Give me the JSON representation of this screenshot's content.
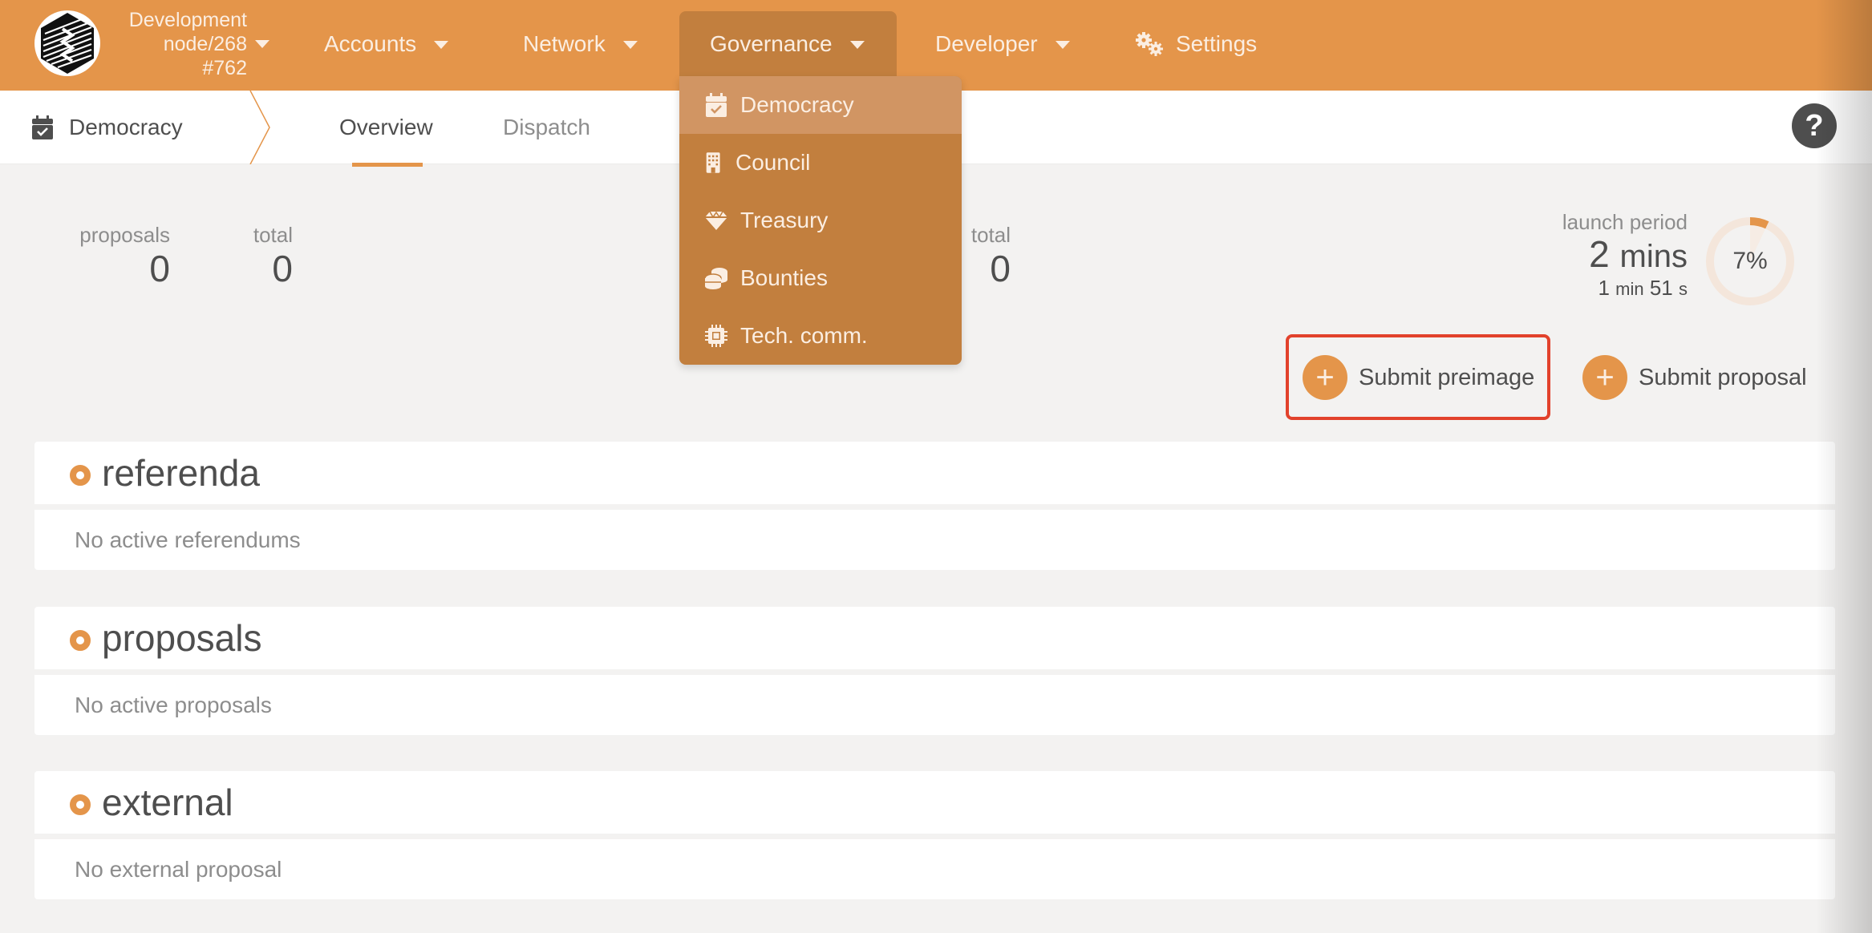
{
  "chain": {
    "name": "Development",
    "node": "node/268",
    "block": "#762"
  },
  "nav": {
    "items": [
      {
        "label": "Accounts",
        "icon": "caret-down-icon"
      },
      {
        "label": "Network",
        "icon": "caret-down-icon"
      },
      {
        "label": "Governance",
        "icon": "caret-down-icon",
        "active": true
      },
      {
        "label": "Developer",
        "icon": "caret-down-icon"
      },
      {
        "label": "Settings",
        "icon": "gear-icon"
      }
    ]
  },
  "governance_menu": {
    "items": [
      {
        "label": "Democracy",
        "icon": "calendar-check-icon",
        "hovered": true
      },
      {
        "label": "Council",
        "icon": "building-icon"
      },
      {
        "label": "Treasury",
        "icon": "gem-icon"
      },
      {
        "label": "Bounties",
        "icon": "coins-icon"
      },
      {
        "label": "Tech. comm.",
        "icon": "microchip-icon"
      }
    ]
  },
  "subheader": {
    "section": "Democracy",
    "section_icon": "calendar-check-icon",
    "tabs": [
      {
        "label": "Overview",
        "active": true
      },
      {
        "label": "Dispatch",
        "active": false
      }
    ],
    "help_label": "?"
  },
  "summary": {
    "stats": [
      {
        "label": "proposals",
        "value": "0"
      },
      {
        "label": "total",
        "value": "0"
      },
      {
        "label": "total",
        "value": "0"
      }
    ],
    "launch_period": {
      "label": "launch period",
      "total_value": "2",
      "total_unit": "mins",
      "remaining_min": "1",
      "remaining_min_unit": "min",
      "remaining_sec": "51",
      "remaining_sec_unit": "s",
      "progress_percent": 7,
      "progress_label": "7%"
    }
  },
  "actions": {
    "submit_preimage": "Submit preimage",
    "submit_proposal": "Submit proposal",
    "plus": "+"
  },
  "sections": [
    {
      "title": "referenda",
      "empty": "No active referendums"
    },
    {
      "title": "proposals",
      "empty": "No active proposals"
    },
    {
      "title": "external",
      "empty": "No external proposal"
    }
  ],
  "colors": {
    "brand": "#e4954a",
    "brand_dark": "#c27f3e",
    "hover": "#d19563",
    "highlight": "#e2422c",
    "text": "#4e4e4e",
    "muted": "#8d8d8d"
  }
}
